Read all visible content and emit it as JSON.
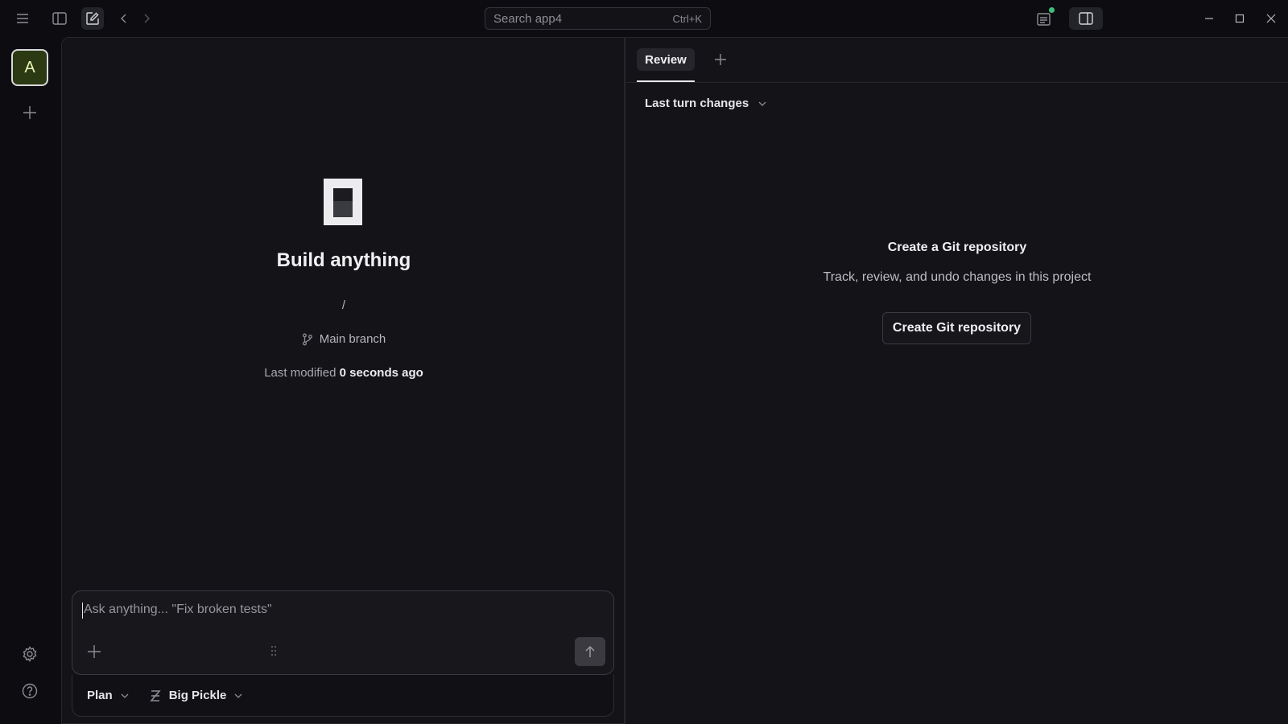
{
  "titlebar": {
    "search_label": "Search app4",
    "search_shortcut": "Ctrl+K"
  },
  "rail": {
    "avatar_letter": "A"
  },
  "chat": {
    "title": "Build anything",
    "path": "/",
    "branch": "Main branch",
    "modified_prefix": "Last modified",
    "modified_value": "0 seconds ago",
    "composer_placeholder": "Ask anything... \"Fix broken tests\"",
    "mode": "Plan",
    "model": "Big Pickle"
  },
  "review": {
    "tab_label": "Review",
    "changes_selector": "Last turn changes",
    "empty_title": "Create a Git repository",
    "empty_subtitle": "Track, review, and undo changes in this project",
    "create_button": "Create Git repository"
  },
  "colors": {
    "background": "#0d0d11",
    "panel": "#131318",
    "avatar_bg": "#2b3a12",
    "notification_dot": "#3fbf7a"
  }
}
